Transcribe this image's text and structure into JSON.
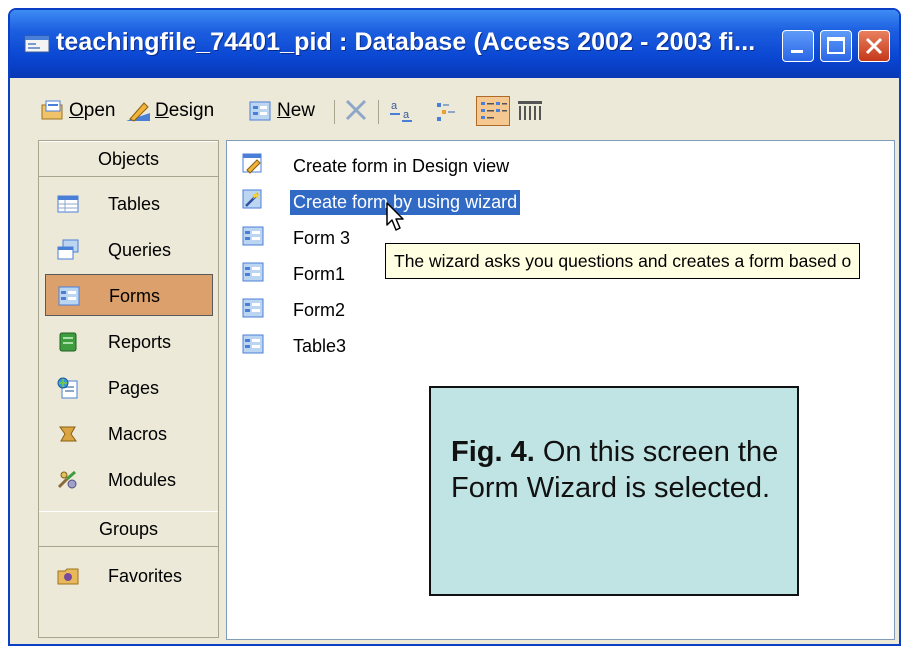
{
  "window": {
    "title": "teachingfile_74401_pid : Database (Access 2002 - 2003 fi...",
    "colors": {
      "title_bar": "#0a46d2",
      "selection": "#316ac5",
      "selected_group": "#dba06b",
      "caption_box": "#c0e4e4",
      "tooltip": "#ffffe1"
    }
  },
  "toolbar": {
    "open_label": "Open",
    "design_label": "Design",
    "new_label": "New"
  },
  "objects_bar": {
    "objects_header": "Objects",
    "items": [
      {
        "label": "Tables",
        "icon": "table-icon"
      },
      {
        "label": "Queries",
        "icon": "query-icon"
      },
      {
        "label": "Forms",
        "icon": "form-icon",
        "selected": true
      },
      {
        "label": "Reports",
        "icon": "report-icon"
      },
      {
        "label": "Pages",
        "icon": "page-icon"
      },
      {
        "label": "Macros",
        "icon": "macro-icon"
      },
      {
        "label": "Modules",
        "icon": "module-icon"
      }
    ],
    "groups_header": "Groups",
    "groups": [
      {
        "label": "Favorites",
        "icon": "favorites-folder-icon"
      }
    ]
  },
  "list": {
    "items": [
      {
        "label": "Create form in Design view",
        "icon": "design-view-icon"
      },
      {
        "label": "Create form by using wizard",
        "icon": "wizard-icon",
        "selected": true
      },
      {
        "label": "Form 3",
        "icon": "form-icon"
      },
      {
        "label": "Form1",
        "icon": "form-icon"
      },
      {
        "label": "Form2",
        "icon": "form-icon"
      },
      {
        "label": "Table3",
        "icon": "form-icon"
      }
    ],
    "tooltip": "The wizard asks you questions and creates a form based o"
  },
  "caption": {
    "label": "Fig. 4.",
    "text": "On this screen the Form Wizard is selected."
  }
}
